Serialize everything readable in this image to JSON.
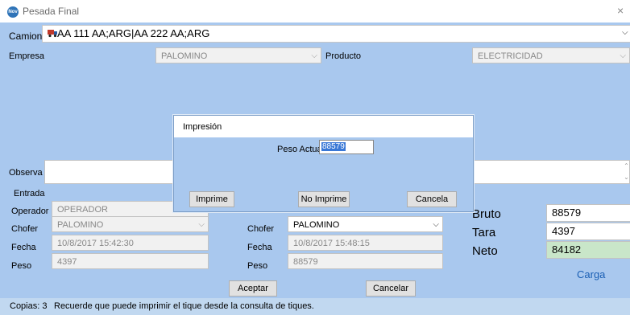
{
  "window": {
    "title": "Pesada Final",
    "close": "×",
    "icon_text": "Nov"
  },
  "camion": {
    "label": "Camion",
    "value": "AA 111 AA;ARG|AA 222 AA;ARG"
  },
  "empresa": {
    "label": "Empresa",
    "value": "PALOMINO"
  },
  "producto": {
    "label": "Producto",
    "value": "ELECTRICIDAD"
  },
  "observa": {
    "label": "Observa",
    "value": ""
  },
  "entrada": {
    "title": "Entrada",
    "operador_label": "Operador",
    "operador_value": "OPERADOR",
    "chofer_label": "Chofer",
    "chofer_value": "PALOMINO",
    "fecha_label": "Fecha",
    "fecha_value": "10/8/2017 15:42:30",
    "peso_label": "Peso",
    "peso_value": "4397"
  },
  "salida": {
    "chofer_label": "Chofer",
    "chofer_value": "PALOMINO",
    "fecha_label": "Fecha",
    "fecha_value": "10/8/2017 15:48:15",
    "peso_label": "Peso",
    "peso_value": "88579"
  },
  "totals": {
    "bruto_label": "Bruto",
    "bruto_value": "88579",
    "tara_label": "Tara",
    "tara_value": "4397",
    "neto_label": "Neto",
    "neto_value": "84182",
    "carga_link": "Carga"
  },
  "buttons": {
    "aceptar": "Aceptar",
    "cancelar": "Cancelar"
  },
  "status": {
    "copias": "Copias: 3",
    "message": "Recuerde que puede imprimir el tique desde la consulta de tiques."
  },
  "dialog": {
    "title": "Impresión",
    "peso_actual_label": "Peso Actual",
    "peso_actual_value": "88579",
    "imprime": "Imprime",
    "no_imprime": "No Imprime",
    "cancela": "Cancela"
  },
  "colors": {
    "form_bg": "#a9c8ee",
    "neto_bg": "#c9e6c9",
    "link": "#1a5fb4",
    "selection": "#3a78d6"
  }
}
